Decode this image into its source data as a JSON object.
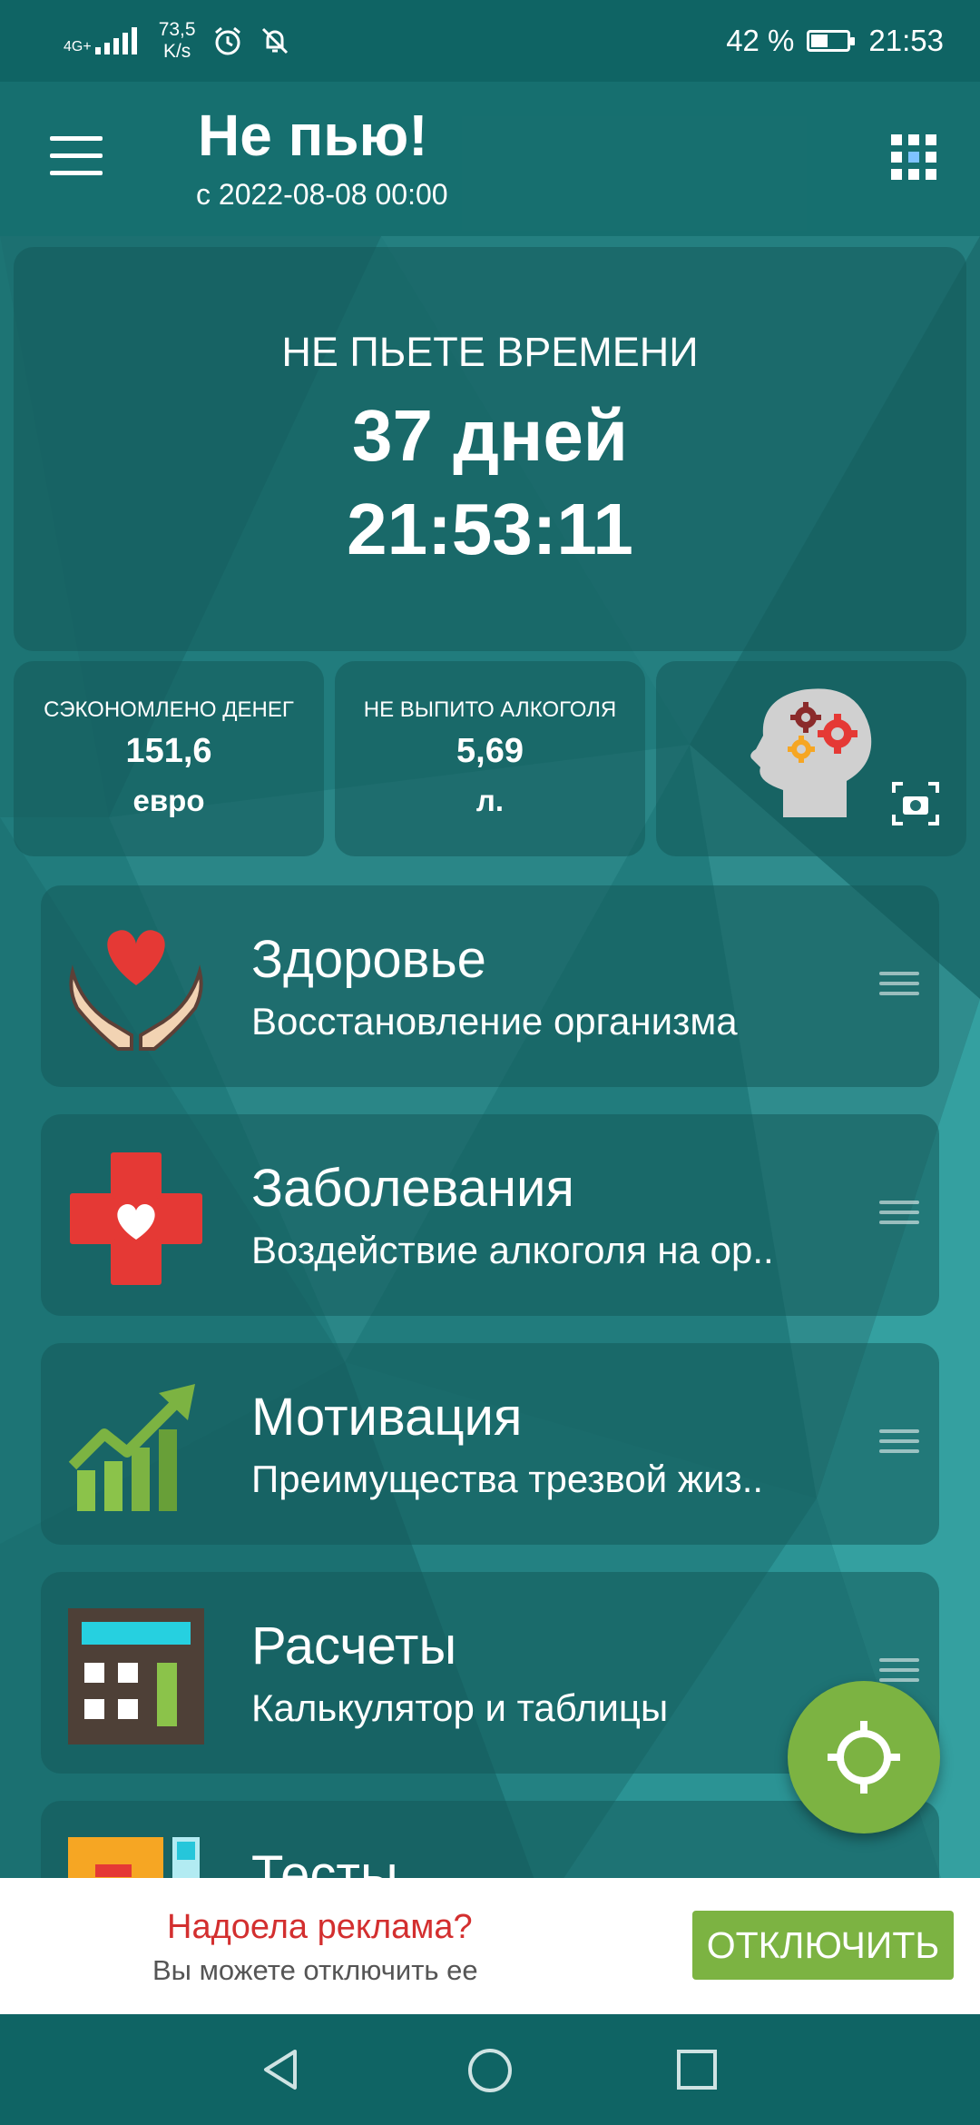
{
  "status_bar": {
    "network": "4G+",
    "speed_value": "73,5",
    "speed_unit": "K/s",
    "battery": "42 %",
    "time": "21:53"
  },
  "app_bar": {
    "title": "Не пью!",
    "subtitle": "с 2022-08-08 00:00",
    "menu_icon": "hamburger-icon",
    "apps_icon": "grid-icon"
  },
  "counter": {
    "label": "НЕ ПЬЕТЕ ВРЕМЕНИ",
    "days": "37 дней",
    "time": "21:53:11"
  },
  "stats": [
    {
      "label": "СЭКОНОМЛЕНО ДЕНЕГ",
      "value": "151,6",
      "unit": "евро"
    },
    {
      "label": "НЕ ВЫПИТО АЛКОГОЛЯ",
      "value": "5,69",
      "unit": "л."
    }
  ],
  "menu": [
    {
      "title": "Здоровье",
      "subtitle": "Восстановление организма",
      "icon": "heart-hands-icon"
    },
    {
      "title": "Заболевания",
      "subtitle": "Воздействие алкоголя на ор..",
      "icon": "medical-cross-icon"
    },
    {
      "title": "Мотивация",
      "subtitle": "Преимущества трезвой жиз..",
      "icon": "growth-chart-icon"
    },
    {
      "title": "Расчеты",
      "subtitle": "Калькулятор и таблицы",
      "icon": "calculator-icon"
    },
    {
      "title": "Тесты",
      "subtitle": "",
      "icon": "tests-icon"
    }
  ],
  "ad": {
    "title": "Надоела реклама?",
    "subtitle": "Вы можете отключить ее",
    "button": "ОТКЛЮЧИТЬ"
  },
  "colors": {
    "teal_dark": "#0f6464",
    "teal": "#1f7b7b",
    "accent_green": "#7cb342",
    "ad_red": "#d32f2f"
  }
}
